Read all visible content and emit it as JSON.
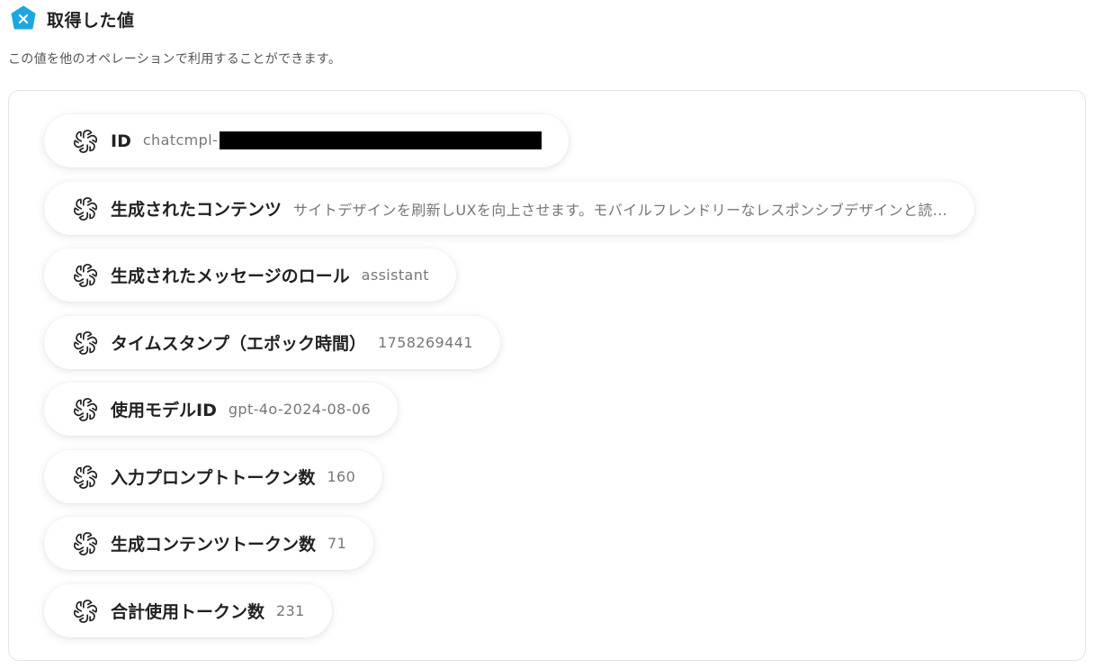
{
  "header": {
    "title": "取得した値",
    "subtitle": "この値を他のオペレーションで利用することができます。",
    "logo_color": "#1ba8e0",
    "logo_icon": "yoom-logo-icon"
  },
  "fields": [
    {
      "label": "ID",
      "value": "chatcmpl-",
      "redacted": true,
      "icon": "openai-icon"
    },
    {
      "label": "生成されたコンテンツ",
      "value": "サイトデザインを刷新しUXを向上させます。モバイルフレンドリーなレスポンシブデザインと読...",
      "icon": "openai-icon"
    },
    {
      "label": "生成されたメッセージのロール",
      "value": "assistant",
      "icon": "openai-icon"
    },
    {
      "label": "タイムスタンプ（エポック時間）",
      "value": "1758269441",
      "icon": "openai-icon"
    },
    {
      "label": "使用モデルID",
      "value": "gpt-4o-2024-08-06",
      "icon": "openai-icon"
    },
    {
      "label": "入力プロンプトトークン数",
      "value": "160",
      "icon": "openai-icon"
    },
    {
      "label": "生成コンテンツトークン数",
      "value": "71",
      "icon": "openai-icon"
    },
    {
      "label": "合計使用トークン数",
      "value": "231",
      "icon": "openai-icon"
    }
  ]
}
